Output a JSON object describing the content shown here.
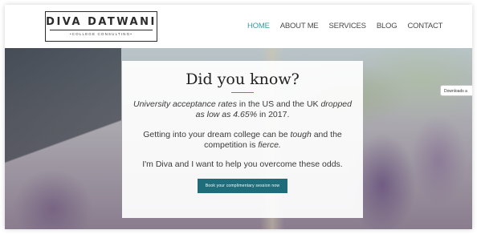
{
  "logo": {
    "name": "DIVA DATWANI",
    "tagline": "•COLLEGE CONSULTING•"
  },
  "nav": {
    "items": [
      {
        "label": "HOME",
        "active": true
      },
      {
        "label": "ABOUT ME",
        "active": false
      },
      {
        "label": "SERVICES",
        "active": false
      },
      {
        "label": "BLOG",
        "active": false
      },
      {
        "label": "CONTACT",
        "active": false
      }
    ]
  },
  "hero": {
    "title": "Did you know?",
    "p1_a": "University acceptance rates",
    "p1_b": " in the US and the UK ",
    "p1_c": "dropped as low as 4.65%",
    "p1_d": " in 2017.",
    "p2_a": "Getting into your dream college can be ",
    "p2_b": "tough",
    "p2_c": " and the competition is ",
    "p2_d": "fierce.",
    "p3": "I'm Diva and I want to help you overcome these odds.",
    "cta_label": "Book your complimentary session now"
  },
  "downloads_tab": {
    "label": "Downloads a"
  },
  "colors": {
    "accent": "#3a9aa2",
    "cta_bg": "#1f6d7a",
    "text": "#3a3a3a"
  }
}
